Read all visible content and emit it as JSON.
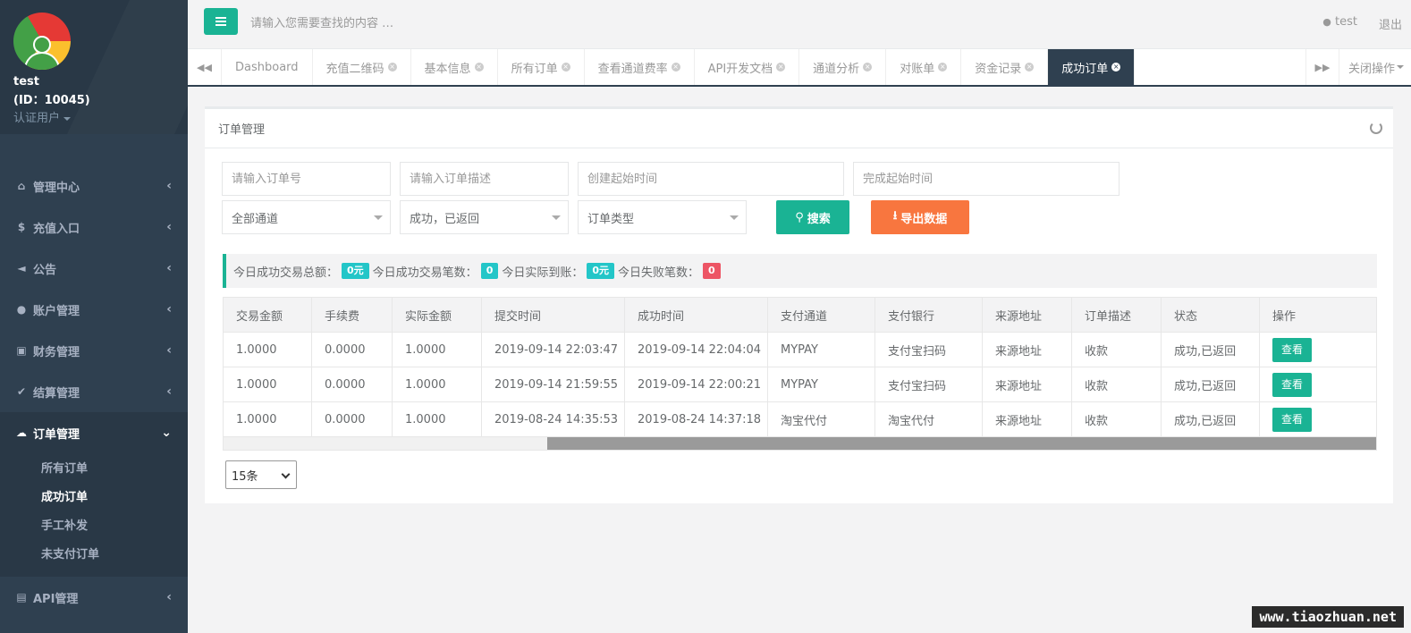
{
  "sidebar": {
    "username": "test",
    "user_id": "(ID：10045)",
    "role": "认证用户",
    "menu": [
      {
        "label": "管理中心",
        "icon": "home-icon"
      },
      {
        "label": "充值入口",
        "icon": "dollar-icon"
      },
      {
        "label": "公告",
        "icon": "volume-icon"
      },
      {
        "label": "账户管理",
        "icon": "user-icon"
      },
      {
        "label": "财务管理",
        "icon": "money-icon"
      },
      {
        "label": "结算管理",
        "icon": "check-icon"
      },
      {
        "label": "订单管理",
        "icon": "cloud-icon"
      }
    ],
    "submenu": [
      "所有订单",
      "成功订单",
      "手工补发",
      "未支付订单"
    ],
    "menu_last": {
      "label": "API管理",
      "icon": "bank-icon"
    }
  },
  "topbar": {
    "search_placeholder": "请输入您需要查找的内容 …",
    "user": "test",
    "logout": "退出"
  },
  "tabs": {
    "items": [
      "Dashboard",
      "充值二维码",
      "基本信息",
      "所有订单",
      "查看通道费率",
      "API开发文档",
      "通道分析",
      "对账单",
      "资金记录",
      "成功订单"
    ],
    "close_ops": "关闭操作"
  },
  "panel": {
    "title": "订单管理",
    "filters": {
      "order_no_placeholder": "请输入订单号",
      "order_desc_placeholder": "请输入订单描述",
      "create_time_placeholder": "创建起始时间",
      "finish_time_placeholder": "完成起始时间",
      "channel": "全部通道",
      "status": "成功，已返回",
      "order_type": "订单类型",
      "search": "搜索",
      "export": "导出数据"
    },
    "summary": {
      "total_label": "今日成功交易总额：",
      "total_value": "0元",
      "count_label": "今日成功交易笔数：",
      "count_value": "0",
      "actual_label": "今日实际到账：",
      "actual_value": "0元",
      "fail_label": "今日失败笔数：",
      "fail_value": "0"
    },
    "table": {
      "headers": [
        "交易金额",
        "手续费",
        "实际金额",
        "提交时间",
        "成功时间",
        "支付通道",
        "支付银行",
        "来源地址",
        "订单描述",
        "状态",
        "操作"
      ],
      "rows": [
        [
          "1.0000",
          "0.0000",
          "1.0000",
          "2019-09-14 22:03:47",
          "2019-09-14 22:04:04",
          "MYPAY",
          "支付宝扫码",
          "来源地址",
          "收款",
          "成功,已返回",
          "查看"
        ],
        [
          "1.0000",
          "0.0000",
          "1.0000",
          "2019-09-14 21:59:55",
          "2019-09-14 22:00:21",
          "MYPAY",
          "支付宝扫码",
          "来源地址",
          "收款",
          "成功,已返回",
          "查看"
        ],
        [
          "1.0000",
          "0.0000",
          "1.0000",
          "2019-08-24 14:35:53",
          "2019-08-24 14:37:18",
          "淘宝代付",
          "淘宝代付",
          "来源地址",
          "收款",
          "成功,已返回",
          "查看"
        ]
      ]
    },
    "page_size": "15条"
  },
  "watermark": "www.tiaozhuan.net",
  "colors": {
    "accent": "#1ab394",
    "sidebar": "#2f4050",
    "export": "#f8763f",
    "info": "#23c6c8",
    "danger": "#ed5565"
  }
}
